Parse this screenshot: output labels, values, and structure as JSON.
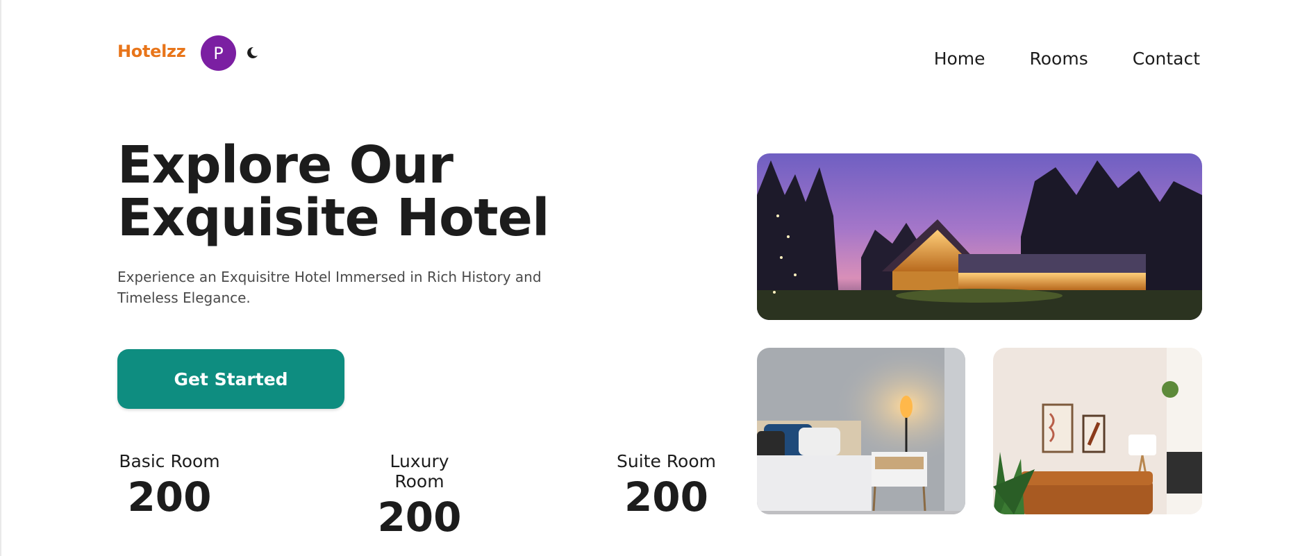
{
  "header": {
    "brand": "Hotelzz",
    "avatar_initial": "P",
    "theme_icon": "moon-icon",
    "nav": [
      "Home",
      "Rooms",
      "Contact"
    ]
  },
  "hero": {
    "title": "Explore Our Exquisite Hotel",
    "subtitle": "Experience an Exquisitre Hotel Immersed in Rich History and Timeless Elegance.",
    "cta_label": "Get Started"
  },
  "stats": [
    {
      "label": "Basic Room",
      "value": "200"
    },
    {
      "label": "Luxury Room",
      "value": "200"
    },
    {
      "label": "Suite Room",
      "value": "200"
    }
  ],
  "colors": {
    "brand": "#e8751a",
    "avatar": "#7b1fa2",
    "cta": "#0e8d80",
    "text": "#1c1c1c"
  }
}
